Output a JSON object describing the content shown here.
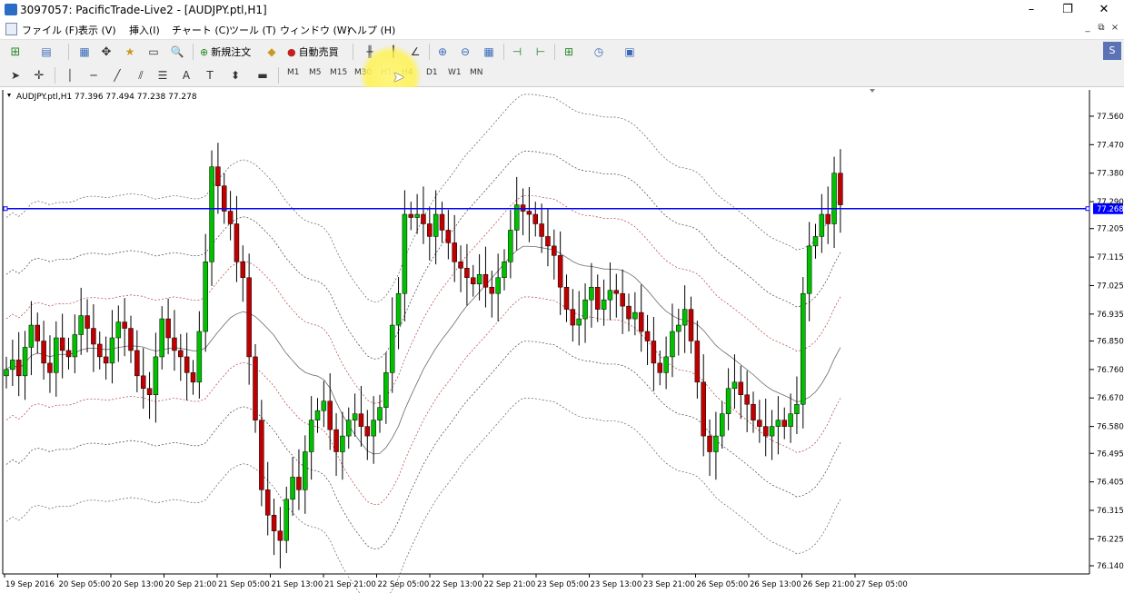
{
  "window": {
    "title": "3097057: PacificTrade-Live2 - [AUDJPY.ptl,H1]",
    "minimize": "–",
    "maximize": "❐",
    "close": "✕"
  },
  "menu": {
    "items": [
      "ファイル (F)",
      "表示 (V)",
      "挿入(I)",
      "チャート (C)",
      "ツール (T)",
      "ウィンドウ (W)",
      "ヘルプ (H)"
    ],
    "mdi_controls": [
      "_",
      "⧉",
      "×"
    ]
  },
  "toolbar": {
    "new_order": "新規注文",
    "auto_trade": "自動売買"
  },
  "timeframes": [
    "M1",
    "M5",
    "M15",
    "M30",
    "H1",
    "H4",
    "D1",
    "W1",
    "MN"
  ],
  "search": {
    "placeholder": ""
  },
  "chart_data": {
    "type": "candlestick",
    "symbol_info": "AUDJPY.ptl,H1  77.396 77.494 77.238 77.278",
    "price_label": "77.268",
    "horizontal_line": 77.268,
    "ylim": [
      76.12,
      77.6
    ],
    "yticks": [
      "77.560",
      "77.470",
      "77.380",
      "77.290",
      "77.205",
      "77.115",
      "77.025",
      "76.935",
      "76.850",
      "76.760",
      "76.670",
      "76.580",
      "76.495",
      "76.405",
      "76.315",
      "76.225",
      "76.140"
    ],
    "xticks": [
      "19 Sep 2016",
      "20 Sep 05:00",
      "20 Sep 13:00",
      "20 Sep 21:00",
      "21 Sep 05:00",
      "21 Sep 13:00",
      "21 Sep 21:00",
      "22 Sep 05:00",
      "22 Sep 13:00",
      "22 Sep 21:00",
      "23 Sep 05:00",
      "23 Sep 13:00",
      "23 Sep 21:00",
      "26 Sep 05:00",
      "26 Sep 13:00",
      "26 Sep 21:00",
      "27 Sep 05:00"
    ],
    "closes": [
      76.76,
      76.79,
      76.74,
      76.83,
      76.9,
      76.85,
      76.78,
      76.75,
      76.86,
      76.82,
      76.8,
      76.87,
      76.93,
      76.89,
      76.84,
      76.8,
      76.78,
      76.86,
      76.91,
      76.89,
      76.82,
      76.74,
      76.7,
      76.68,
      76.8,
      76.92,
      76.86,
      76.82,
      76.8,
      76.75,
      76.72,
      76.88,
      77.1,
      77.4,
      77.34,
      77.26,
      77.22,
      77.1,
      77.05,
      76.8,
      76.6,
      76.38,
      76.3,
      76.25,
      76.22,
      76.35,
      76.42,
      76.38,
      76.5,
      76.6,
      76.63,
      76.66,
      76.57,
      76.5,
      76.55,
      76.6,
      76.62,
      76.58,
      76.55,
      76.6,
      76.64,
      76.75,
      76.9,
      77.0,
      77.25,
      77.24,
      77.25,
      77.22,
      77.18,
      77.25,
      77.2,
      77.16,
      77.1,
      77.08,
      77.05,
      77.03,
      77.06,
      77.02,
      77.0,
      77.05,
      77.1,
      77.2,
      77.28,
      77.26,
      77.25,
      77.22,
      77.18,
      77.15,
      77.12,
      77.02,
      76.95,
      76.9,
      76.92,
      76.98,
      77.02,
      76.95,
      76.98,
      77.01,
      77.0,
      76.96,
      76.92,
      76.94,
      76.88,
      76.85,
      76.78,
      76.75,
      76.8,
      76.88,
      76.9,
      76.95,
      76.85,
      76.72,
      76.55,
      76.5,
      76.55,
      76.62,
      76.7,
      76.72,
      76.68,
      76.65,
      76.6,
      76.58,
      76.55,
      76.58,
      76.6,
      76.58,
      76.62,
      76.65,
      77.0,
      77.15,
      77.18,
      77.25,
      77.22,
      77.38,
      77.28
    ],
    "colors": {
      "up": "#00c000",
      "down": "#c00000",
      "line": "#0000ff"
    }
  }
}
